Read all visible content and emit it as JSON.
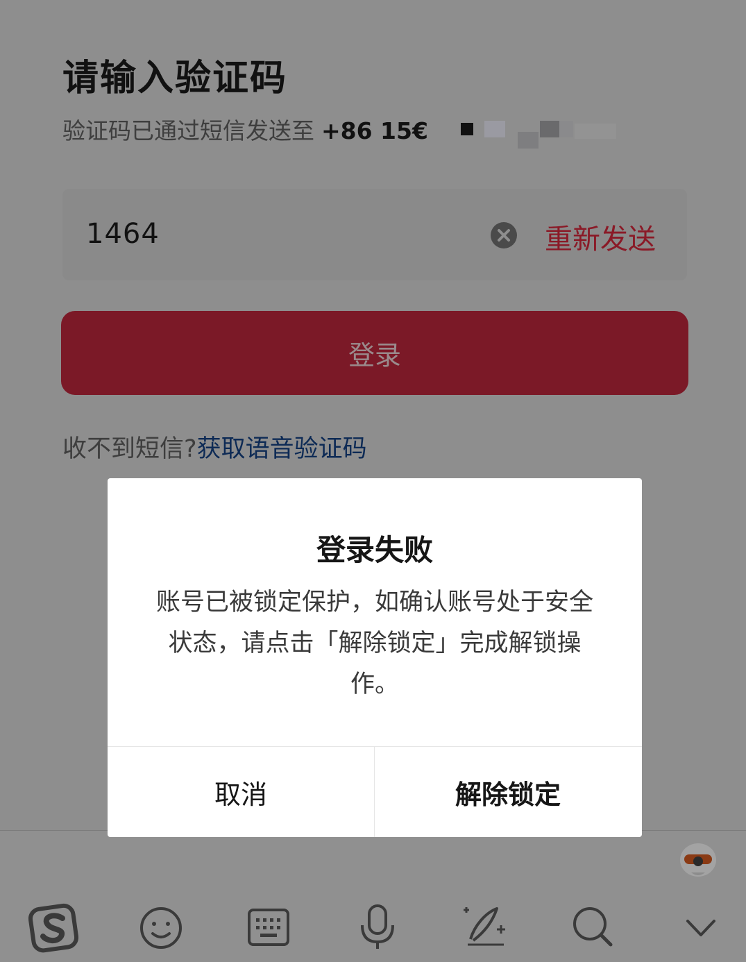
{
  "header": {
    "title": "请输入验证码",
    "subtitle_prefix": "验证码已通过短信发送至",
    "phone_visible": "+86 15€"
  },
  "code_input": {
    "value": "1464",
    "clear_icon": "clear-icon",
    "resend_label": "重新发送"
  },
  "login_button": {
    "label": "登录"
  },
  "sms_help": {
    "question": "收不到短信?",
    "voice_link": "获取语音验证码"
  },
  "dialog": {
    "title": "登录失败",
    "message": "账号已被锁定保护，如确认账号处于安全状态，请点击「解除锁定」完成解锁操作。",
    "cancel_label": "取消",
    "unlock_label": "解除锁定"
  },
  "keyboard_toolbar": {
    "icons": [
      "sogou-logo-icon",
      "emoji-icon",
      "keyboard-icon",
      "microphone-icon",
      "handwriting-icon",
      "search-icon",
      "collapse-chevron-icon"
    ]
  },
  "colors": {
    "accent_red": "#8a1a27",
    "link_blue": "#0d2a55",
    "overlay_gray": "#8e8e8e",
    "dialog_bg": "#ffffff"
  }
}
